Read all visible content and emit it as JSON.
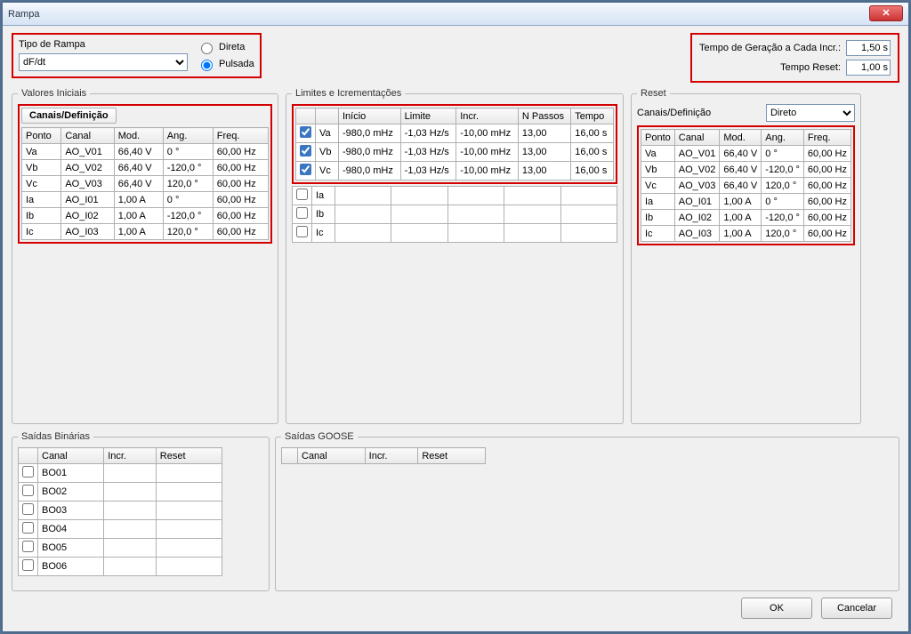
{
  "window": {
    "title": "Rampa"
  },
  "tipo": {
    "label": "Tipo de Rampa",
    "selected": "dF/dt",
    "direta": "Direta",
    "pulsada": "Pulsada"
  },
  "geracao": {
    "label1": "Tempo de Geração a Cada Incr.:",
    "val1": "1,50 s",
    "label2": "Tempo Reset:",
    "val2": "1,00 s"
  },
  "valores_iniciais": {
    "legend": "Valores Iniciais",
    "tab": "Canais/Definição",
    "headers": {
      "ponto": "Ponto",
      "canal": "Canal",
      "mod": "Mod.",
      "ang": "Ang.",
      "freq": "Freq."
    },
    "rows": [
      {
        "ponto": "Va",
        "canal": "AO_V01",
        "mod": "66,40 V",
        "ang": "0 °",
        "freq": "60,00 Hz"
      },
      {
        "ponto": "Vb",
        "canal": "AO_V02",
        "mod": "66,40 V",
        "ang": "-120,0 °",
        "freq": "60,00 Hz"
      },
      {
        "ponto": "Vc",
        "canal": "AO_V03",
        "mod": "66,40 V",
        "ang": "120,0 °",
        "freq": "60,00 Hz"
      },
      {
        "ponto": "Ia",
        "canal": "AO_I01",
        "mod": "1,00 A",
        "ang": "0 °",
        "freq": "60,00 Hz"
      },
      {
        "ponto": "Ib",
        "canal": "AO_I02",
        "mod": "1,00 A",
        "ang": "-120,0 °",
        "freq": "60,00 Hz"
      },
      {
        "ponto": "Ic",
        "canal": "AO_I03",
        "mod": "1,00 A",
        "ang": "120,0 °",
        "freq": "60,00 Hz"
      }
    ]
  },
  "limites": {
    "legend": "Limites e Icrementações",
    "headers": {
      "blank": "",
      "nome": "",
      "inicio": "Início",
      "limite": "Limite",
      "incr": "Incr.",
      "npassos": "N Passos",
      "tempo": "Tempo"
    },
    "rows": [
      {
        "chk": true,
        "nome": "Va",
        "inicio": "-980,0 mHz",
        "limite": "-1,03 Hz/s",
        "incr": "-10,00 mHz",
        "npassos": "13,00",
        "tempo": "16,00 s"
      },
      {
        "chk": true,
        "nome": "Vb",
        "inicio": "-980,0 mHz",
        "limite": "-1,03 Hz/s",
        "incr": "-10,00 mHz",
        "npassos": "13,00",
        "tempo": "16,00 s"
      },
      {
        "chk": true,
        "nome": "Vc",
        "inicio": "-980,0 mHz",
        "limite": "-1,03 Hz/s",
        "incr": "-10,00 mHz",
        "npassos": "13,00",
        "tempo": "16,00 s"
      },
      {
        "chk": false,
        "nome": "Ia",
        "inicio": "",
        "limite": "",
        "incr": "",
        "npassos": "",
        "tempo": ""
      },
      {
        "chk": false,
        "nome": "Ib",
        "inicio": "",
        "limite": "",
        "incr": "",
        "npassos": "",
        "tempo": ""
      },
      {
        "chk": false,
        "nome": "Ic",
        "inicio": "",
        "limite": "",
        "incr": "",
        "npassos": "",
        "tempo": ""
      }
    ]
  },
  "reset": {
    "legend": "Reset",
    "tab": "Canais/Definição",
    "dropdown": "Direto",
    "headers": {
      "ponto": "Ponto",
      "canal": "Canal",
      "mod": "Mod.",
      "ang": "Ang.",
      "freq": "Freq."
    },
    "rows": [
      {
        "ponto": "Va",
        "canal": "AO_V01",
        "mod": "66,40 V",
        "ang": "0 °",
        "freq": "60,00 Hz"
      },
      {
        "ponto": "Vb",
        "canal": "AO_V02",
        "mod": "66,40 V",
        "ang": "-120,0 °",
        "freq": "60,00 Hz"
      },
      {
        "ponto": "Vc",
        "canal": "AO_V03",
        "mod": "66,40 V",
        "ang": "120,0 °",
        "freq": "60,00 Hz"
      },
      {
        "ponto": "Ia",
        "canal": "AO_I01",
        "mod": "1,00 A",
        "ang": "0 °",
        "freq": "60,00 Hz"
      },
      {
        "ponto": "Ib",
        "canal": "AO_I02",
        "mod": "1,00 A",
        "ang": "-120,0 °",
        "freq": "60,00 Hz"
      },
      {
        "ponto": "Ic",
        "canal": "AO_I03",
        "mod": "1,00 A",
        "ang": "120,0 °",
        "freq": "60,00 Hz"
      }
    ]
  },
  "saidas_binarias": {
    "legend": "Saídas Binárias",
    "headers": {
      "canal": "Canal",
      "incr": "Incr.",
      "reset": "Reset"
    },
    "rows": [
      {
        "nome": "BO01"
      },
      {
        "nome": "BO02"
      },
      {
        "nome": "BO03"
      },
      {
        "nome": "BO04"
      },
      {
        "nome": "BO05"
      },
      {
        "nome": "BO06"
      }
    ]
  },
  "saidas_goose": {
    "legend": "Saídas GOOSE",
    "headers": {
      "canal": "Canal",
      "incr": "Incr.",
      "reset": "Reset"
    }
  },
  "buttons": {
    "ok": "OK",
    "cancel": "Cancelar"
  }
}
